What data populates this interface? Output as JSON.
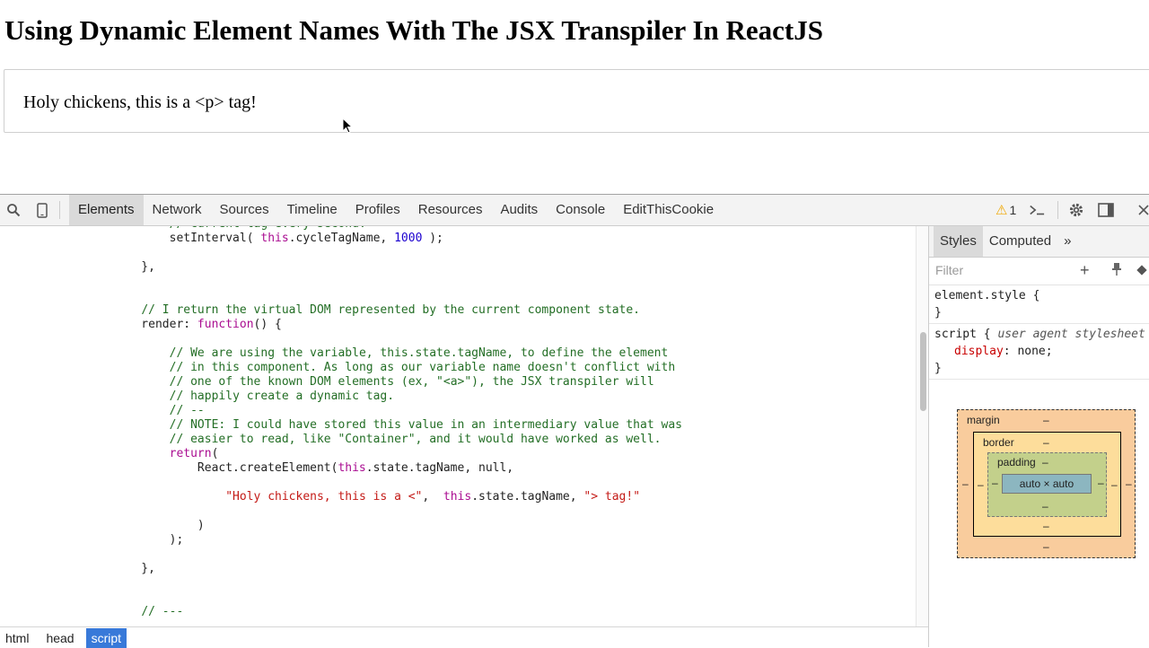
{
  "page": {
    "heading": "Using Dynamic Element Names With The JSX Transpiler In ReactJS",
    "demo_text": "Holy chickens, this is a <p> tag!"
  },
  "devtools": {
    "tabs": [
      "Elements",
      "Network",
      "Sources",
      "Timeline",
      "Profiles",
      "Resources",
      "Audits",
      "Console",
      "EditThisCookie"
    ],
    "active_tab": "Elements",
    "warning_count": "1",
    "icons": {
      "search": "search-icon",
      "device": "device-mode-icon",
      "console": "console-drawer-icon",
      "settings": "gear-icon",
      "dock": "dock-side-icon",
      "close": "close-icon"
    }
  },
  "code_lines": [
    "        // current tag every second.",
    "        setInterval( this.cycleTagName, 1000 );",
    "",
    "    },",
    "",
    "",
    "    // I return the virtual DOM represented by the current component state.",
    "    render: function() {",
    "",
    "        // We are using the variable, this.state.tagName, to define the element",
    "        // in this component. As long as our variable name doesn't conflict with",
    "        // one of the known DOM elements (ex, \"<a>\"), the JSX transpiler will",
    "        // happily create a dynamic tag.",
    "        // --",
    "        // NOTE: I could have stored this value in an intermediary value that was",
    "        // easier to read, like \"Container\", and it would have worked as well.",
    "        return(",
    "            React.createElement(this.state.tagName, null,",
    "",
    "                \"Holy chickens, this is a <\",  this.state.tagName, \"> tag!\"",
    "",
    "            )",
    "        );",
    "",
    "    },",
    "",
    "",
    "    // ---"
  ],
  "breadcrumbs": [
    "html",
    "head",
    "script"
  ],
  "active_breadcrumb": "script",
  "sidebar": {
    "tabs": [
      "Styles",
      "Computed"
    ],
    "more": "»",
    "filter_placeholder": "Filter",
    "rules": {
      "element_style_selector": "element.style {",
      "element_style_close": "}",
      "script_selector": "script {",
      "script_origin": "user agent stylesheet",
      "script_property": "display",
      "script_value": "none;",
      "script_close": "}"
    },
    "box_model": {
      "margin_label": "margin",
      "border_label": "border",
      "padding_label": "padding",
      "content": "auto × auto",
      "dash": "–"
    }
  },
  "colors": {
    "comment": "#236e25",
    "keyword": "#aa0d91",
    "string": "#c41a16",
    "number": "#1c00cf",
    "breadcrumb_active": "#3879d9",
    "margin_box": "#f9cc9d",
    "border_box": "#fddd9b",
    "padding_box": "#c3d08b",
    "content_box": "#8cb6c0"
  }
}
